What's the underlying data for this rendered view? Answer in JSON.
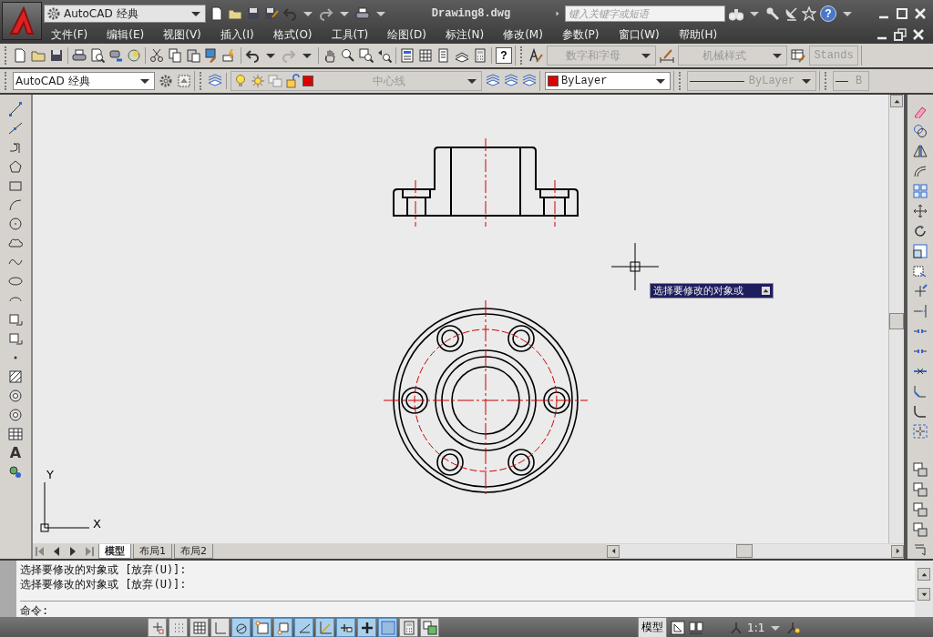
{
  "title_bar": {
    "workspace": "AutoCAD 经典",
    "title": "Drawing8.dwg",
    "search": {
      "placeholder": "键入关键字或短语"
    },
    "help_button": "?"
  },
  "menu_bar": [
    "文件(F)",
    "编辑(E)",
    "视图(V)",
    "插入(I)",
    "格式(O)",
    "工具(T)",
    "绘图(D)",
    "标注(N)",
    "修改(M)",
    "参数(P)",
    "窗口(W)",
    "帮助(H)"
  ],
  "standard_toolbar": {
    "help_key": "?"
  },
  "styles_toolbar": {
    "text_style": "数字和字母",
    "dim_style": "机械样式",
    "table_style": "Stands"
  },
  "properties_toolbar": {
    "workspace": "AutoCAD 经典",
    "layer": {
      "name": "中心线",
      "color": "#dd0000"
    },
    "color": {
      "name": "ByLayer",
      "color": "#dd0000"
    },
    "linetype": "ByLayer",
    "lineweight": "B"
  },
  "draw_toolbar": {
    "text_tool": "A"
  },
  "canvas": {
    "tooltip": "选择要修改的对象或",
    "ucs": {
      "x": "X",
      "y": "Y"
    }
  },
  "layout_tabs": [
    {
      "label": "模型",
      "selected": true
    },
    {
      "label": "布局1",
      "selected": false
    },
    {
      "label": "布局2",
      "selected": false
    }
  ],
  "command_history": [
    "选择要修改的对象或 [放弃(U)]:",
    "选择要修改的对象或 [放弃(U)]:"
  ],
  "command_prompt": "命令:",
  "status_toggles": [
    {
      "on": false
    },
    {
      "on": false
    },
    {
      "on": false
    },
    {
      "on": false
    },
    {
      "on": true
    },
    {
      "on": true
    },
    {
      "on": true
    },
    {
      "on": true
    },
    {
      "on": true
    },
    {
      "on": true
    },
    {
      "on": true
    },
    {
      "on": true
    },
    {
      "on": false
    },
    {
      "on": false
    }
  ],
  "status_right": {
    "model": "模型",
    "scale": "1:1"
  }
}
